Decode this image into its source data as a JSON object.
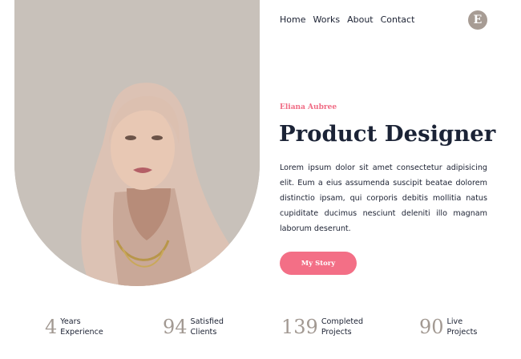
{
  "nav": {
    "items": [
      "Home",
      "Works",
      "About",
      "Contact"
    ]
  },
  "logo": {
    "letter": "E"
  },
  "hero": {
    "name": "Eliana Aubree",
    "title": "Product Designer",
    "description": "Lorem ipsum dolor sit amet consectetur adipisicing elit. Eum a eius assumenda suscipit beatae dolorem distinctio ipsam, qui corporis debitis mollitia natus cupiditate ducimus nesciunt deleniti illo magnam laborum deserunt.",
    "cta_label": "My Story"
  },
  "stats": [
    {
      "value": "4",
      "line1": "Years",
      "line2": "Experience"
    },
    {
      "value": "94",
      "line1": "Satisfied",
      "line2": "Clients"
    },
    {
      "value": "139",
      "line1": "Completed",
      "line2": "Projects"
    },
    {
      "value": "90",
      "line1": "Live",
      "line2": "Projects"
    }
  ],
  "colors": {
    "accent": "#f36f86",
    "heading": "#1b2336",
    "stat_number": "#a29992",
    "photo_bg": "#c8c1ba"
  }
}
